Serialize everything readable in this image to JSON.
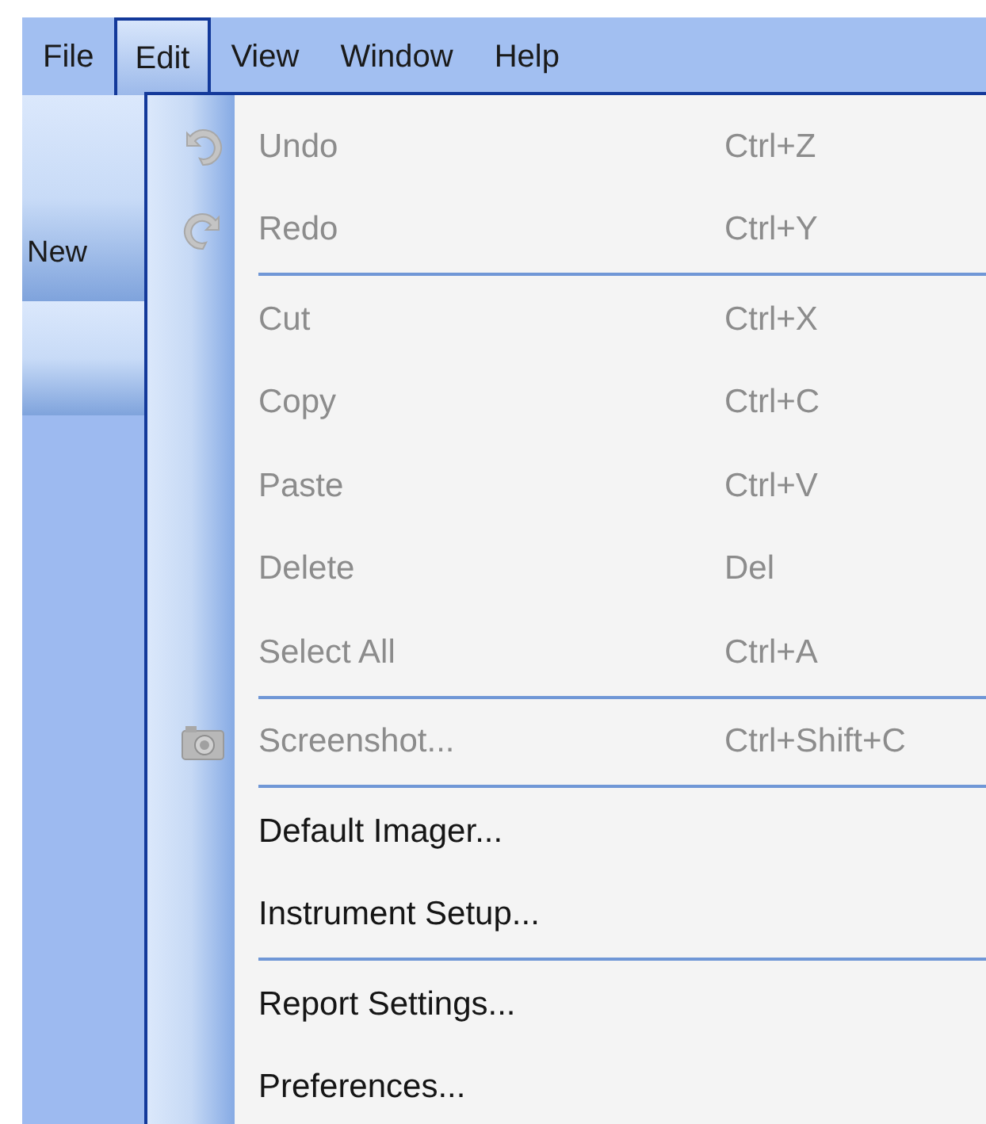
{
  "menu_bar": [
    {
      "label": "File",
      "selected": false
    },
    {
      "label": "Edit",
      "selected": true
    },
    {
      "label": "View",
      "selected": false
    },
    {
      "label": "Window",
      "selected": false
    },
    {
      "label": "Help",
      "selected": false
    }
  ],
  "side_panel": {
    "buttons": [
      {
        "label": "New"
      }
    ]
  },
  "edit_menu": [
    {
      "kind": "item",
      "label": "Undo",
      "shortcut": "Ctrl+Z",
      "disabled": true
    },
    {
      "kind": "item",
      "label": "Redo",
      "shortcut": "Ctrl+Y",
      "disabled": true
    },
    {
      "kind": "separator"
    },
    {
      "kind": "item",
      "label": "Cut",
      "shortcut": "Ctrl+X",
      "disabled": true
    },
    {
      "kind": "item",
      "label": "Copy",
      "shortcut": "Ctrl+C",
      "disabled": true
    },
    {
      "kind": "item",
      "label": "Paste",
      "shortcut": "Ctrl+V",
      "disabled": true
    },
    {
      "kind": "item",
      "label": "Delete",
      "shortcut": "Del",
      "disabled": true
    },
    {
      "kind": "item",
      "label": "Select All",
      "shortcut": "Ctrl+A",
      "disabled": true
    },
    {
      "kind": "separator"
    },
    {
      "kind": "item",
      "label": "Screenshot...",
      "shortcut": "Ctrl+Shift+C",
      "disabled": true
    },
    {
      "kind": "separator"
    },
    {
      "kind": "item",
      "label": "Default Imager...",
      "disabled": false
    },
    {
      "kind": "item",
      "label": "Instrument Setup...",
      "disabled": false
    },
    {
      "kind": "separator"
    },
    {
      "kind": "item",
      "label": "Report Settings...",
      "disabled": false
    },
    {
      "kind": "item",
      "label": "Preferences...",
      "disabled": false
    }
  ]
}
